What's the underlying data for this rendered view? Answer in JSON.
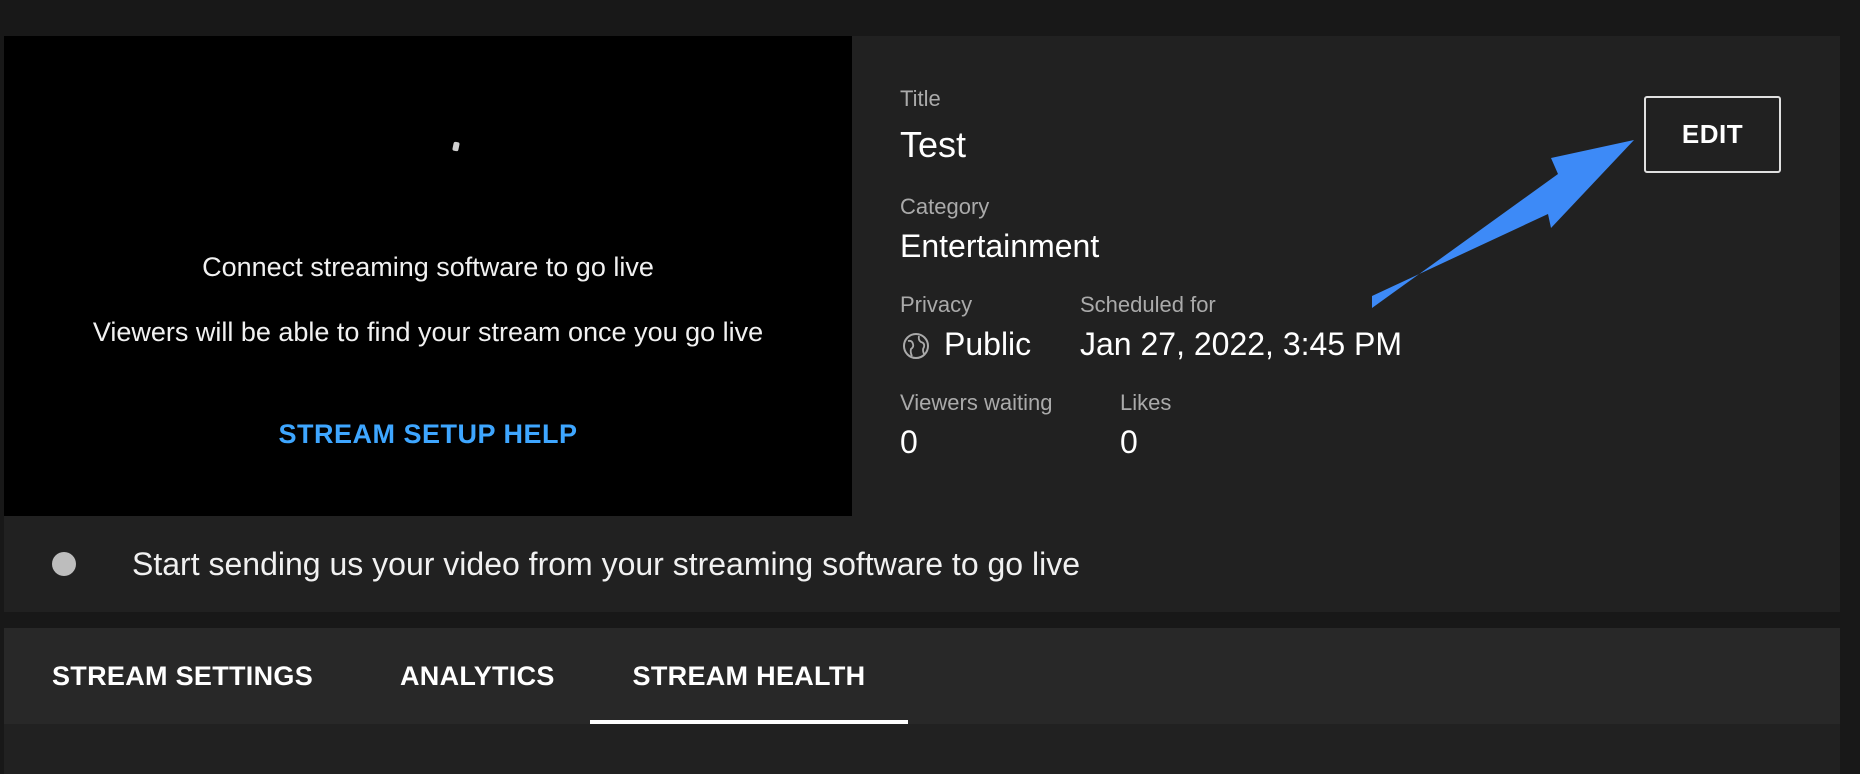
{
  "preview": {
    "connect_text": "Connect streaming software to go live",
    "viewers_text": "Viewers will be able to find your stream once you go live",
    "setup_help_label": "STREAM SETUP HELP"
  },
  "details": {
    "title_label": "Title",
    "title_value": "Test",
    "category_label": "Category",
    "category_value": "Entertainment",
    "privacy_label": "Privacy",
    "privacy_value": "Public",
    "privacy_icon": "globe-icon",
    "scheduled_label": "Scheduled for",
    "scheduled_value": "Jan 27, 2022, 3:45 PM",
    "viewers_waiting_label": "Viewers waiting",
    "viewers_waiting_value": "0",
    "likes_label": "Likes",
    "likes_value": "0",
    "edit_label": "EDIT"
  },
  "status": {
    "text": "Start sending us your video from your streaming software to go live"
  },
  "tabs": [
    {
      "label": "STREAM SETTINGS"
    },
    {
      "label": "ANALYTICS"
    },
    {
      "label": "STREAM HEALTH",
      "active": true
    }
  ],
  "colors": {
    "accent_link": "#3ea6ff",
    "annotation_arrow": "#3d8af7"
  }
}
